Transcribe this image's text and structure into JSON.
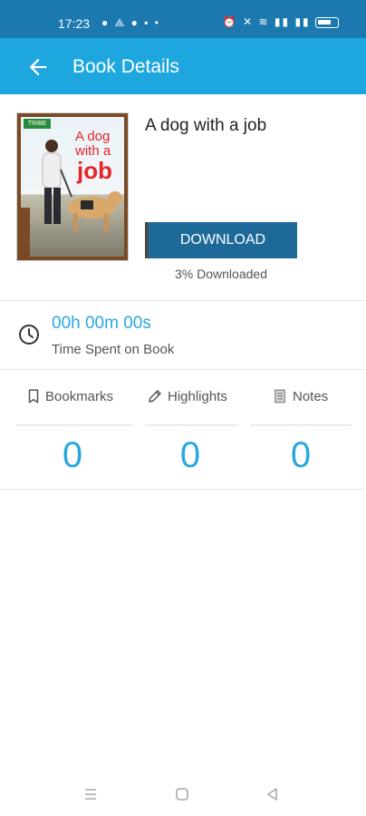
{
  "status_bar": {
    "time": "17:23",
    "left_icons": "● ⟁ ● ▪ •",
    "right_icons": "⏰ ✕ ≋ ▮▮ ▮▮"
  },
  "header": {
    "title": "Book Details",
    "back_icon": "arrow-left-icon"
  },
  "book": {
    "title": "A dog with a job",
    "cover": {
      "badge": "TRIBE",
      "title_line1": "A dog",
      "title_line2": "with a",
      "title_line3": "job"
    },
    "download_button": "DOWNLOAD",
    "download_status": "3% Downloaded",
    "download_progress": 3
  },
  "time_spent": {
    "value": "00h 00m 00s",
    "label": "Time Spent on Book",
    "icon": "clock-icon"
  },
  "stats": [
    {
      "label": "Bookmarks",
      "icon": "bookmark-icon",
      "count": "0"
    },
    {
      "label": "Highlights",
      "icon": "pencil-icon",
      "count": "0"
    },
    {
      "label": "Notes",
      "icon": "notepad-icon",
      "count": "0"
    }
  ],
  "colors": {
    "status_bar": "#1b79b0",
    "app_bar": "#1ea7df",
    "download_button": "#1d6a98",
    "accent_text": "#29a8e0"
  },
  "nav_bar": {
    "menu_icon": "menu-icon",
    "home_icon": "home-square-icon",
    "back_icon": "back-triangle-icon"
  }
}
